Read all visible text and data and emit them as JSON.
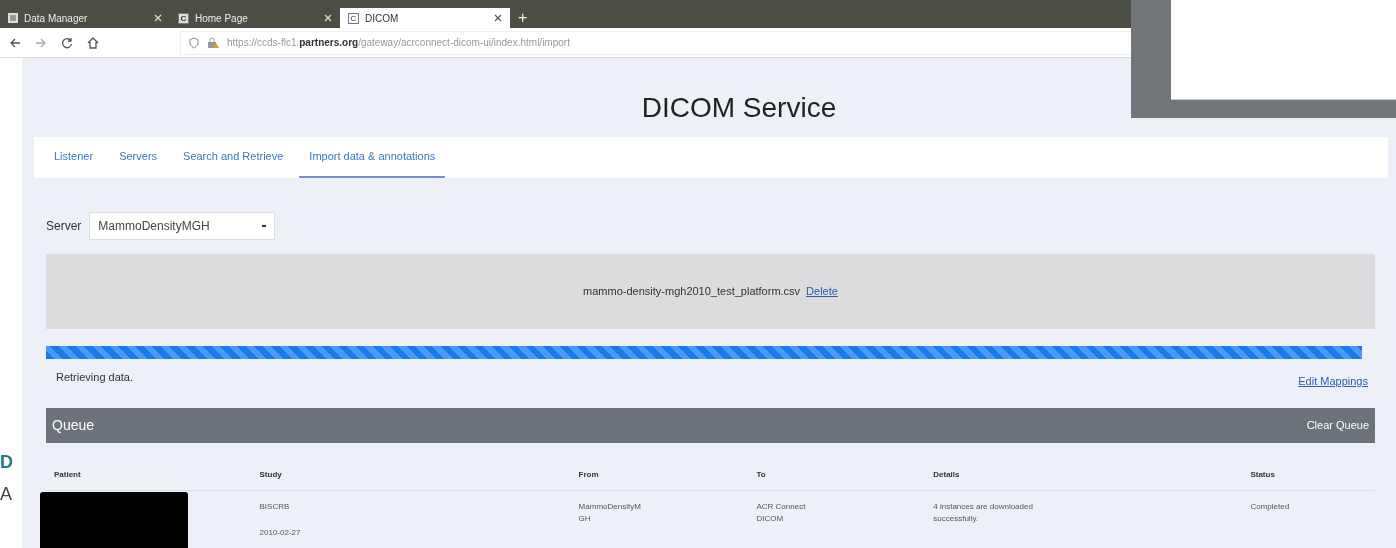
{
  "browser": {
    "tabs": [
      {
        "title": "Data Manager",
        "selected": false
      },
      {
        "title": "Home Page",
        "favicon_letter": "C",
        "selected": false
      },
      {
        "title": "DICOM",
        "favicon_letter": "C",
        "selected": true
      }
    ],
    "new_tab": "+",
    "url": {
      "prefix": "https://ccds-flc1.",
      "domain": "partners.org",
      "path": "/gateway/acrconnect-dicom-ui/index.html/import"
    }
  },
  "page": {
    "title": "DICOM Service",
    "nav": [
      {
        "label": "Listener",
        "selected": false
      },
      {
        "label": "Servers",
        "selected": false
      },
      {
        "label": "Search and Retrieve",
        "selected": false
      },
      {
        "label": "Import data & annotations",
        "selected": true
      }
    ],
    "server": {
      "label": "Server",
      "value": "MammoDensityMGH"
    },
    "file": {
      "name": "mammo-density-mgh2010_test_platform.csv",
      "delete": "Delete"
    },
    "progress": {
      "level": 1
    },
    "status_text": "Retrieving data.",
    "edit_mappings": "Edit Mappings",
    "queue": {
      "title": "Queue",
      "clear": "Clear Queue",
      "columns": [
        "Patient",
        "Study",
        "From",
        "To",
        "Details",
        "Status"
      ],
      "rows": [
        {
          "redacted": true,
          "study": [
            "BISCRB",
            "2010-02-27"
          ],
          "from": "MammoDensityM\nGH",
          "to": "ACR Connect\nDICOM",
          "details": "4 instances are downloaded\nsuccessfully.",
          "status": "Completed"
        }
      ]
    }
  },
  "left_edge": [
    "D",
    "A"
  ]
}
